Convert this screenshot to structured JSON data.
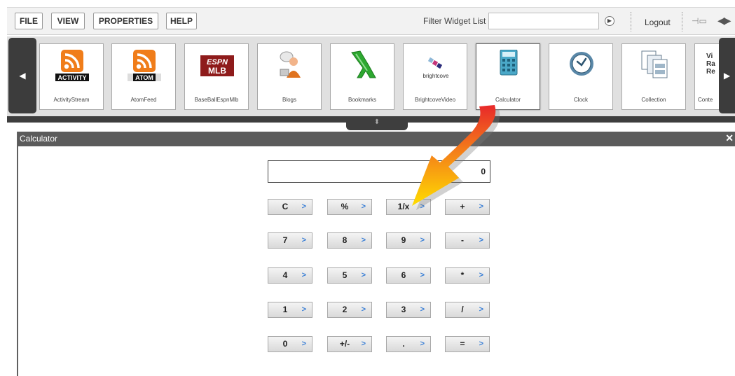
{
  "menubar": {
    "file": "FILE",
    "view": "VIEW",
    "properties": "PROPERTIES",
    "help": "HELP",
    "filter_label": "Filter Widget List",
    "filter_value": "",
    "logout": "Logout"
  },
  "widgets": [
    {
      "label": "ActivityStream",
      "badge": "ACTIVITY"
    },
    {
      "label": "AtomFeed",
      "badge": "ATOM"
    },
    {
      "label": "BaseBallEspnMlb",
      "badge_top": "ESPN",
      "badge_bottom": "MLB"
    },
    {
      "label": "Blogs"
    },
    {
      "label": "Bookmarks"
    },
    {
      "label": "BrightcoveVideo",
      "badge": "brightcove"
    },
    {
      "label": "Calculator"
    },
    {
      "label": "Clock"
    },
    {
      "label": "Collection"
    },
    {
      "label": "Conte",
      "partial_lines": [
        "Vi",
        "Ra",
        "Re"
      ]
    }
  ],
  "calculator": {
    "title": "Calculator",
    "display": "0",
    "keys": [
      [
        "C",
        "%",
        "1/x",
        "+"
      ],
      [
        "7",
        "8",
        "9",
        "-"
      ],
      [
        "4",
        "5",
        "6",
        "*"
      ],
      [
        "1",
        "2",
        "3",
        "/"
      ],
      [
        "0",
        "+/-",
        ".",
        "="
      ]
    ],
    "key_arrow": ">"
  },
  "colors": {
    "accent_arrow": "#3a7fd6",
    "titlebar": "#5b5b5b",
    "rss_orange": "#f07d1a"
  }
}
